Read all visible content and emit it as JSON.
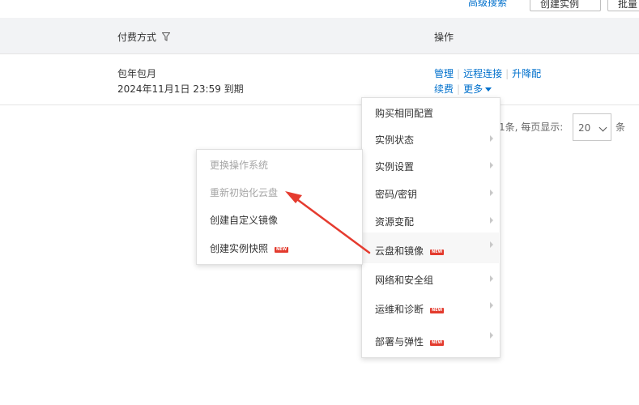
{
  "toolbar": {
    "link_label": "高级搜索",
    "btn1_label": "创建实例",
    "btn2_label": "批量"
  },
  "table": {
    "headers": {
      "payment": "付费方式",
      "ops": "操作"
    },
    "row": {
      "payment_type": "包年包月",
      "expiry": "2024年11月1日 23:59 到期",
      "ops_manage": "管理",
      "ops_remote": "远程连接",
      "ops_change": "升降配",
      "ops_renew": "续费",
      "ops_more": "更多"
    }
  },
  "pager": {
    "summary": "1条, 每页显示:",
    "page_size": "20",
    "unit": "条"
  },
  "main_menu": {
    "items": [
      {
        "label": "购买相同配置"
      },
      {
        "label": "实例状态"
      },
      {
        "label": "实例设置"
      },
      {
        "label": "密码/密钥"
      },
      {
        "label": "资源变配"
      },
      {
        "label": "云盘和镜像",
        "badge": "NEW"
      },
      {
        "label": "网络和安全组"
      },
      {
        "label": "运维和诊断",
        "badge": "NEW"
      },
      {
        "label": "部署与弹性",
        "badge": "NEW"
      }
    ]
  },
  "sub_menu": {
    "items": [
      {
        "label": "更换操作系统"
      },
      {
        "label": "重新初始化云盘"
      },
      {
        "label": "创建自定义镜像"
      },
      {
        "label": "创建实例快照",
        "badge": "NEW"
      }
    ]
  },
  "colors": {
    "accent": "#0070cc",
    "annotation": "#e53b2f",
    "badge": "#e33b2e"
  }
}
